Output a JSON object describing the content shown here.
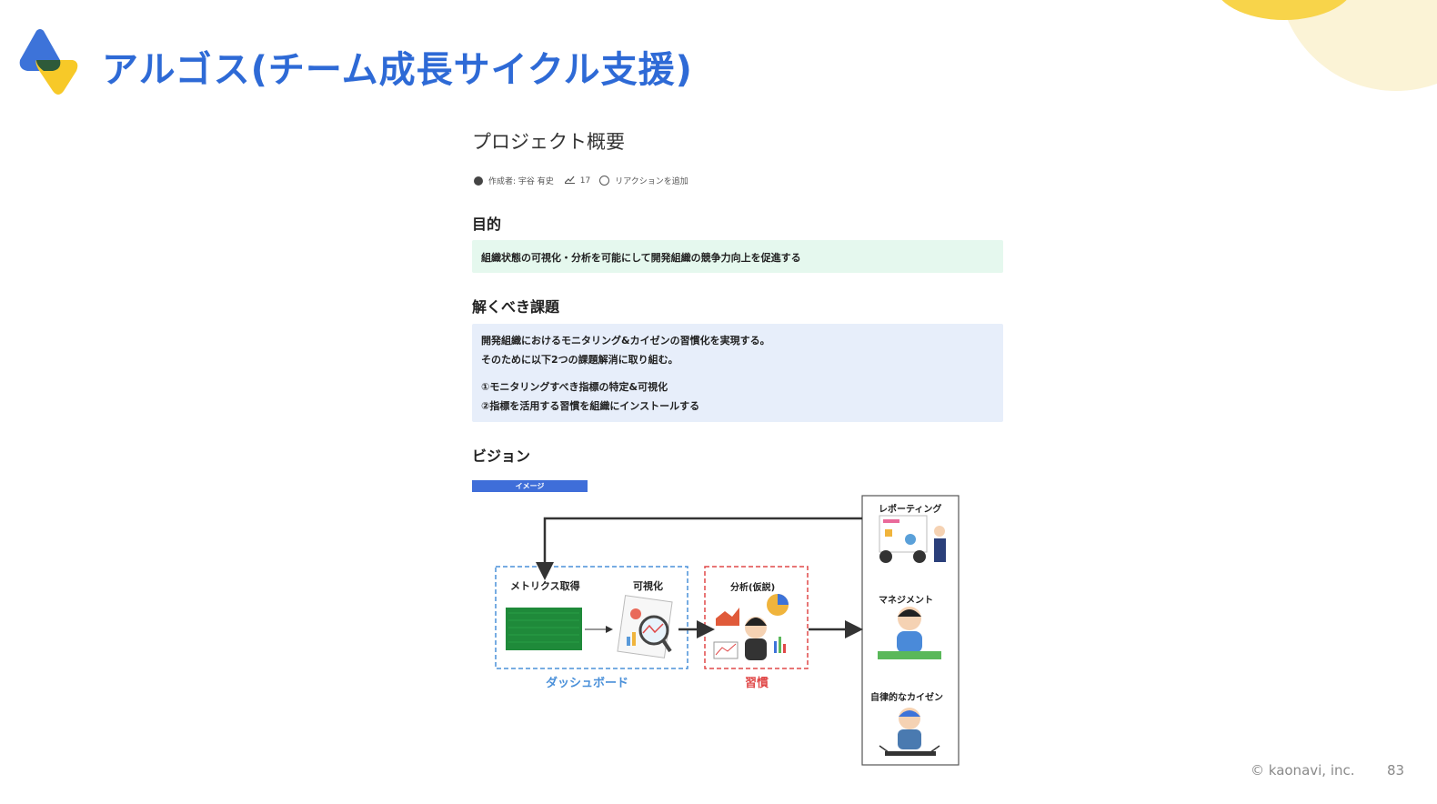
{
  "slide": {
    "title": "アルゴス(チーム成長サイクル支援)",
    "copyright": "© kaonavi, inc.",
    "page_number": "83",
    "colors": {
      "title": "#2e6ad6",
      "logo_blue": "#3d73d9",
      "logo_yellow": "#f7c928",
      "deco_yellow": "#f8d44a"
    }
  },
  "doc": {
    "title": "プロジェクト概要",
    "meta": {
      "author": "作成者: 宇谷 有史",
      "views": "17",
      "reaction": "リアクションを追加"
    },
    "purpose": {
      "heading": "目的",
      "text": "組織状態の可視化・分析を可能にして開発組織の競争力向上を促進する"
    },
    "issues": {
      "heading": "解くべき課題",
      "lines": [
        "開発組織におけるモニタリング&カイゼンの習慣化を実現する。",
        "そのために以下2つの課題解消に取り組む。",
        "①モニタリングすべき指標の特定&可視化",
        "②指標を活用する習慣を組織にインストールする"
      ]
    },
    "vision": {
      "heading": "ビジョン",
      "badge": "イメージ",
      "diagram": {
        "metrics": "メトリクス取得",
        "visualize": "可視化",
        "dashboard": "ダッシュボード",
        "analysis": "分析(仮説)",
        "habit": "習慣",
        "reporting": "レポーティング",
        "management": "マネジメント",
        "kaizen": "自律的なカイゼン",
        "colors": {
          "dashboard": "#4a90d9",
          "habit": "#e04848"
        }
      }
    }
  }
}
